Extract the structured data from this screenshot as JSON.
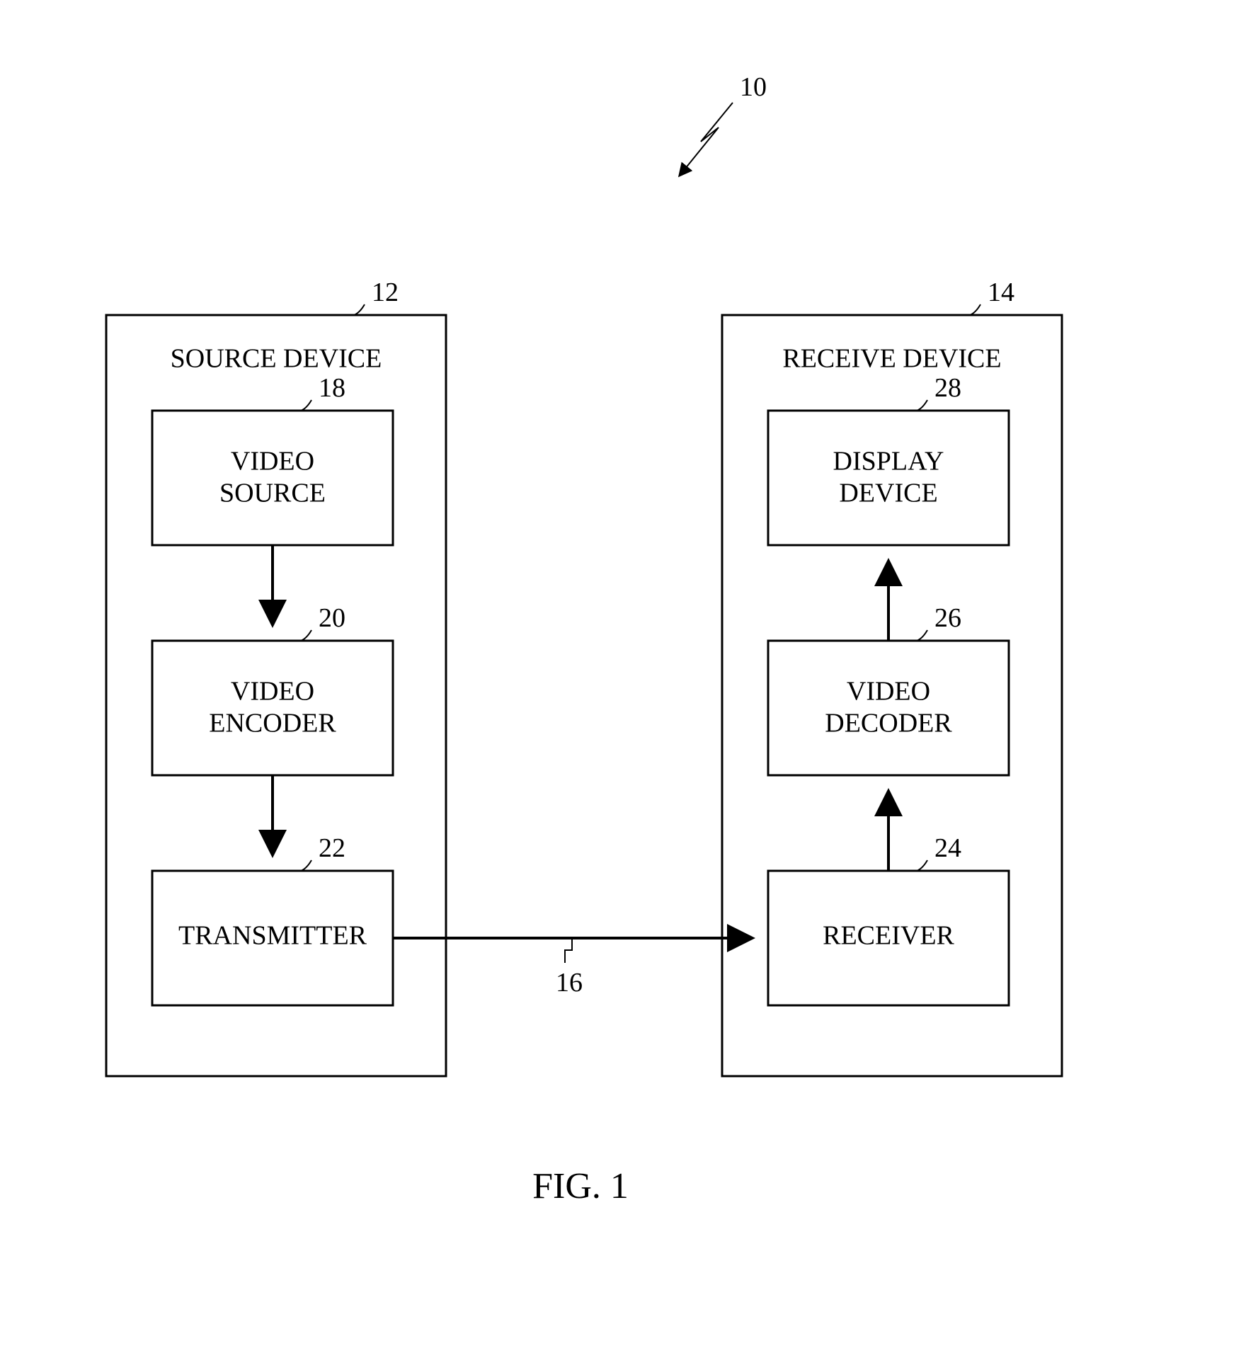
{
  "system": {
    "ref": "10"
  },
  "channel": {
    "ref": "16"
  },
  "figure": {
    "caption": "FIG. 1"
  },
  "source_device": {
    "title": "SOURCE DEVICE",
    "ref": "12",
    "video_source": {
      "label1": "VIDEO",
      "label2": "SOURCE",
      "ref": "18"
    },
    "video_encoder": {
      "label1": "VIDEO",
      "label2": "ENCODER",
      "ref": "20"
    },
    "transmitter": {
      "label": "TRANSMITTER",
      "ref": "22"
    }
  },
  "receive_device": {
    "title": "RECEIVE DEVICE",
    "ref": "14",
    "display_device": {
      "label1": "DISPLAY",
      "label2": "DEVICE",
      "ref": "28"
    },
    "video_decoder": {
      "label1": "VIDEO",
      "label2": "DECODER",
      "ref": "26"
    },
    "receiver": {
      "label": "RECEIVER",
      "ref": "24"
    }
  }
}
